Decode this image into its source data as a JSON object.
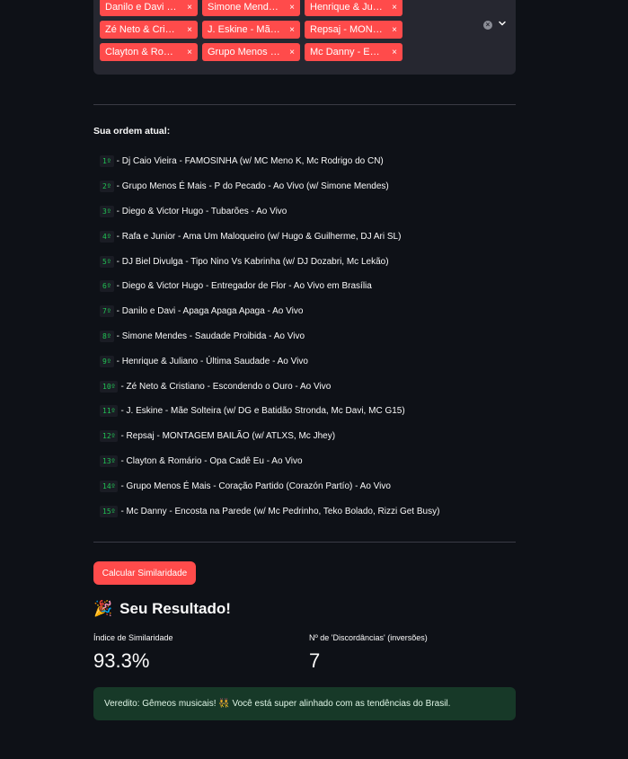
{
  "multiselect": {
    "tags": [
      "Danilo e Davi - A…",
      "Simone Mendes …",
      "Henrique & Julia…",
      "Zé Neto & Cristia…",
      "J. Eskine - Mãe S…",
      "Repsaj - MONTA…",
      "Clayton & Romár…",
      "Grupo Menos É …",
      "Mc Danny - Enco…"
    ],
    "tag_remove_glyph": "×",
    "clear_glyph": "×"
  },
  "order": {
    "title": "Sua ordem atual:",
    "items": [
      {
        "rank": "1º",
        "text": " - Dj Caio Vieira - FAMOSINHA (w/ MC Meno K, Mc Rodrigo do CN)"
      },
      {
        "rank": "2º",
        "text": " - Grupo Menos É Mais - P do Pecado - Ao Vivo (w/ Simone Mendes)"
      },
      {
        "rank": "3º",
        "text": " - Diego & Victor Hugo - Tubarões - Ao Vivo"
      },
      {
        "rank": "4º",
        "text": " - Rafa e Junior - Ama Um Maloqueiro (w/ Hugo & Guilherme, DJ Ari SL)"
      },
      {
        "rank": "5º",
        "text": " - DJ Biel Divulga - Tipo Nino Vs Kabrinha (w/ DJ Dozabri, Mc Lekão)"
      },
      {
        "rank": "6º",
        "text": " - Diego & Victor Hugo - Entregador de Flor - Ao Vivo em Brasília"
      },
      {
        "rank": "7º",
        "text": " - Danilo e Davi - Apaga Apaga Apaga - Ao Vivo"
      },
      {
        "rank": "8º",
        "text": " - Simone Mendes - Saudade Proibida - Ao Vivo"
      },
      {
        "rank": "9º",
        "text": " - Henrique & Juliano - Última Saudade - Ao Vivo"
      },
      {
        "rank": "10º",
        "text": " - Zé Neto & Cristiano - Escondendo o Ouro - Ao Vivo"
      },
      {
        "rank": "11º",
        "text": " - J. Eskine - Mãe Solteira (w/ DG e Batidão Stronda, Mc Davi, MC G15)"
      },
      {
        "rank": "12º",
        "text": " - Repsaj - MONTAGEM BAILÃO (w/ ATLXS, Mc Jhey)"
      },
      {
        "rank": "13º",
        "text": " - Clayton & Romário - Opa Cadê Eu - Ao Vivo"
      },
      {
        "rank": "14º",
        "text": " - Grupo Menos É Mais - Coração Partido (Corazón Partío) - Ao Vivo"
      },
      {
        "rank": "15º",
        "text": " - Mc Danny - Encosta na Parede (w/ Mc Pedrinho, Teko Bolado, Rizzi Get Busy)"
      }
    ]
  },
  "calc_button_label": "Calcular Similaridade",
  "result": {
    "icon": "🎉",
    "title": "Seu Resultado!"
  },
  "metrics": [
    {
      "label": "Índice de Similaridade",
      "value": "93.3%"
    },
    {
      "label": "Nº de 'Discordâncias' (inversões)",
      "value": "7"
    }
  ],
  "verdict": "Veredito: Gêmeos musicais! 👯 Você está super alinhado com as tendências do Brasil.",
  "colors": {
    "background": "#0e1117",
    "accent": "#ff4b4b",
    "rank_green": "#21c354",
    "success_bg": "#173928"
  }
}
